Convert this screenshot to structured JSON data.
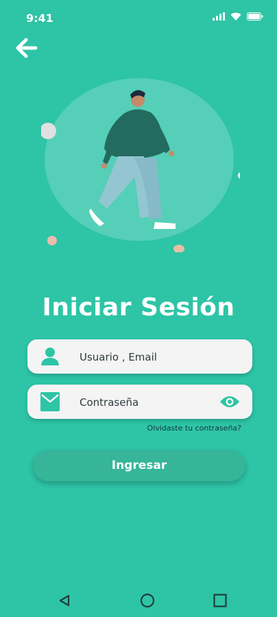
{
  "status_bar": {
    "time": "9:41",
    "icons": [
      "signal-icon",
      "wifi-icon",
      "battery-icon"
    ]
  },
  "header": {
    "back_icon": "arrow-left-icon"
  },
  "main": {
    "title": "Iniciar Sesión",
    "username_field": {
      "placeholder": "Usuario , Email",
      "icon": "user-icon"
    },
    "password_field": {
      "placeholder": "Contraseña",
      "icon": "mail-icon",
      "toggle_icon": "eye-icon"
    },
    "forgot_password": "Olvidaste tu contraseña?",
    "login_button": "Ingresar"
  },
  "navigation_bar": {
    "icons": [
      "back-triangle-icon",
      "home-circle-icon",
      "recents-square-icon"
    ]
  },
  "colors": {
    "background": "#2ec4a6",
    "field_background": "#f4f4f4",
    "accent": "#2ec4a6",
    "button": "#36b599"
  }
}
